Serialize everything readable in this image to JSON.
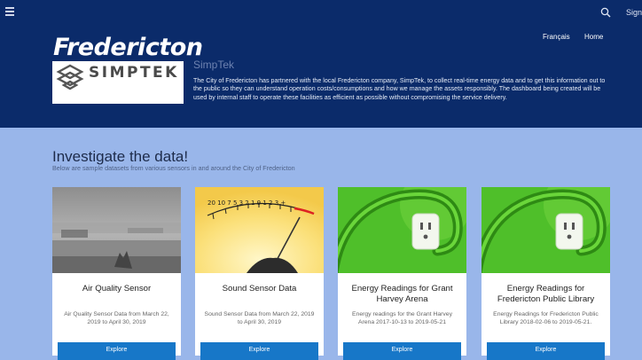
{
  "header": {
    "logo_text": "Fredericton",
    "sign_label": "Sign",
    "nav": {
      "french": "Français",
      "home": "Home"
    },
    "colors": {
      "header_bg": "#0b2b6a",
      "page_bg": "#99b6ea",
      "button": "#1777c8"
    }
  },
  "partner": {
    "title": "SimpTek",
    "logo_text": "SIMPTEK",
    "description": "The City of Fredericton has partnered with the local Fredericton company, SimpTek, to collect real-time energy data and to get this information out to the public so they can understand operation costs/consumptions and how we manage the assets responsibly. The dashboard being created will be used by internal staff to operate these facilities as efficient as possible without compromising the service delivery."
  },
  "section": {
    "title": "Investigate the data!",
    "subtitle": "Below are sample datasets from various sensors in and around the City of Fredericton"
  },
  "cards": [
    {
      "title": "Air Quality Sensor",
      "description": "Air Quality Sensor Data from March 22, 2019 to April 30, 2019",
      "button": "Explore",
      "image": "foggy-lake-photo"
    },
    {
      "title": "Sound Sensor Data",
      "description": "Sound Sensor Data from March 22, 2019 to April 30, 2019",
      "button": "Explore",
      "image": "vu-meter-photo"
    },
    {
      "title": "Energy Readings for Grant Harvey Arena",
      "description": "Energy readings for the Grant Harvey Arena 2017-10-13 to 2019-05-21",
      "button": "Explore",
      "image": "power-plug-photo"
    },
    {
      "title": "Energy Readings for Fredericton Public Library",
      "description": "Energy Readings for Fredericton Public Library 2018-02-06 to 2019-05-21.",
      "button": "Explore",
      "image": "power-plug-photo"
    }
  ],
  "meter_scale": "20 10 7 5 3 2 1 0 1 2 3 +"
}
